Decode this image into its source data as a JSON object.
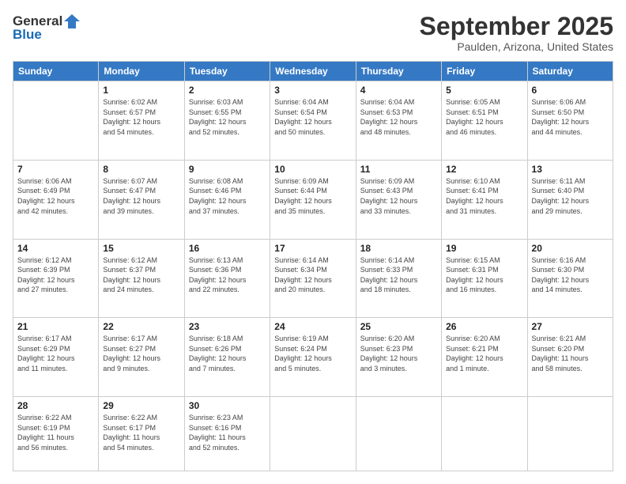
{
  "logo": {
    "line1": "General",
    "line2": "Blue"
  },
  "header": {
    "month": "September 2025",
    "location": "Paulden, Arizona, United States"
  },
  "weekdays": [
    "Sunday",
    "Monday",
    "Tuesday",
    "Wednesday",
    "Thursday",
    "Friday",
    "Saturday"
  ],
  "weeks": [
    [
      {
        "day": "",
        "info": ""
      },
      {
        "day": "1",
        "info": "Sunrise: 6:02 AM\nSunset: 6:57 PM\nDaylight: 12 hours\nand 54 minutes."
      },
      {
        "day": "2",
        "info": "Sunrise: 6:03 AM\nSunset: 6:55 PM\nDaylight: 12 hours\nand 52 minutes."
      },
      {
        "day": "3",
        "info": "Sunrise: 6:04 AM\nSunset: 6:54 PM\nDaylight: 12 hours\nand 50 minutes."
      },
      {
        "day": "4",
        "info": "Sunrise: 6:04 AM\nSunset: 6:53 PM\nDaylight: 12 hours\nand 48 minutes."
      },
      {
        "day": "5",
        "info": "Sunrise: 6:05 AM\nSunset: 6:51 PM\nDaylight: 12 hours\nand 46 minutes."
      },
      {
        "day": "6",
        "info": "Sunrise: 6:06 AM\nSunset: 6:50 PM\nDaylight: 12 hours\nand 44 minutes."
      }
    ],
    [
      {
        "day": "7",
        "info": "Sunrise: 6:06 AM\nSunset: 6:49 PM\nDaylight: 12 hours\nand 42 minutes."
      },
      {
        "day": "8",
        "info": "Sunrise: 6:07 AM\nSunset: 6:47 PM\nDaylight: 12 hours\nand 39 minutes."
      },
      {
        "day": "9",
        "info": "Sunrise: 6:08 AM\nSunset: 6:46 PM\nDaylight: 12 hours\nand 37 minutes."
      },
      {
        "day": "10",
        "info": "Sunrise: 6:09 AM\nSunset: 6:44 PM\nDaylight: 12 hours\nand 35 minutes."
      },
      {
        "day": "11",
        "info": "Sunrise: 6:09 AM\nSunset: 6:43 PM\nDaylight: 12 hours\nand 33 minutes."
      },
      {
        "day": "12",
        "info": "Sunrise: 6:10 AM\nSunset: 6:41 PM\nDaylight: 12 hours\nand 31 minutes."
      },
      {
        "day": "13",
        "info": "Sunrise: 6:11 AM\nSunset: 6:40 PM\nDaylight: 12 hours\nand 29 minutes."
      }
    ],
    [
      {
        "day": "14",
        "info": "Sunrise: 6:12 AM\nSunset: 6:39 PM\nDaylight: 12 hours\nand 27 minutes."
      },
      {
        "day": "15",
        "info": "Sunrise: 6:12 AM\nSunset: 6:37 PM\nDaylight: 12 hours\nand 24 minutes."
      },
      {
        "day": "16",
        "info": "Sunrise: 6:13 AM\nSunset: 6:36 PM\nDaylight: 12 hours\nand 22 minutes."
      },
      {
        "day": "17",
        "info": "Sunrise: 6:14 AM\nSunset: 6:34 PM\nDaylight: 12 hours\nand 20 minutes."
      },
      {
        "day": "18",
        "info": "Sunrise: 6:14 AM\nSunset: 6:33 PM\nDaylight: 12 hours\nand 18 minutes."
      },
      {
        "day": "19",
        "info": "Sunrise: 6:15 AM\nSunset: 6:31 PM\nDaylight: 12 hours\nand 16 minutes."
      },
      {
        "day": "20",
        "info": "Sunrise: 6:16 AM\nSunset: 6:30 PM\nDaylight: 12 hours\nand 14 minutes."
      }
    ],
    [
      {
        "day": "21",
        "info": "Sunrise: 6:17 AM\nSunset: 6:29 PM\nDaylight: 12 hours\nand 11 minutes."
      },
      {
        "day": "22",
        "info": "Sunrise: 6:17 AM\nSunset: 6:27 PM\nDaylight: 12 hours\nand 9 minutes."
      },
      {
        "day": "23",
        "info": "Sunrise: 6:18 AM\nSunset: 6:26 PM\nDaylight: 12 hours\nand 7 minutes."
      },
      {
        "day": "24",
        "info": "Sunrise: 6:19 AM\nSunset: 6:24 PM\nDaylight: 12 hours\nand 5 minutes."
      },
      {
        "day": "25",
        "info": "Sunrise: 6:20 AM\nSunset: 6:23 PM\nDaylight: 12 hours\nand 3 minutes."
      },
      {
        "day": "26",
        "info": "Sunrise: 6:20 AM\nSunset: 6:21 PM\nDaylight: 12 hours\nand 1 minute."
      },
      {
        "day": "27",
        "info": "Sunrise: 6:21 AM\nSunset: 6:20 PM\nDaylight: 11 hours\nand 58 minutes."
      }
    ],
    [
      {
        "day": "28",
        "info": "Sunrise: 6:22 AM\nSunset: 6:19 PM\nDaylight: 11 hours\nand 56 minutes."
      },
      {
        "day": "29",
        "info": "Sunrise: 6:22 AM\nSunset: 6:17 PM\nDaylight: 11 hours\nand 54 minutes."
      },
      {
        "day": "30",
        "info": "Sunrise: 6:23 AM\nSunset: 6:16 PM\nDaylight: 11 hours\nand 52 minutes."
      },
      {
        "day": "",
        "info": ""
      },
      {
        "day": "",
        "info": ""
      },
      {
        "day": "",
        "info": ""
      },
      {
        "day": "",
        "info": ""
      }
    ]
  ]
}
